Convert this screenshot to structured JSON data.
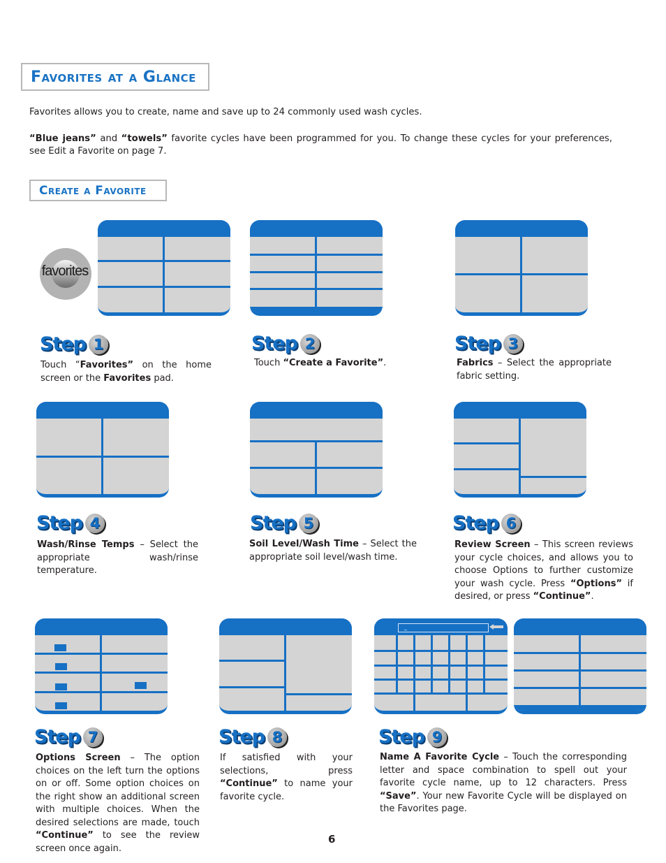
{
  "headings": {
    "main": "Favorites at a Glance",
    "sub": "Create a Favorite"
  },
  "intro": {
    "p1": "Favorites allows you to create, name and save up to 24 commonly used wash cycles.",
    "p2_bold1": "“Blue jeans”",
    "p2_mid1": " and ",
    "p2_bold2": "“towels”",
    "p2_rest": " favorite cycles have been programmed for you.  To change these cycles for your preferences, see Edit a Favorite on page 7."
  },
  "favorites_pad": {
    "label": "favorites",
    "icon": "favorites-button-icon"
  },
  "step_word": "Step",
  "steps": [
    {
      "num": "1",
      "parts": [
        [
          "",
          "Touch “"
        ],
        [
          "b",
          "Favorites”"
        ],
        [
          "",
          " on the home screen or the "
        ],
        [
          "b",
          "Favorites"
        ],
        [
          "",
          " pad."
        ]
      ]
    },
    {
      "num": "2",
      "parts": [
        [
          "",
          "Touch "
        ],
        [
          "b",
          "“Create a Favorite”"
        ],
        [
          "",
          "."
        ]
      ]
    },
    {
      "num": "3",
      "parts": [
        [
          "b",
          "Fabrics"
        ],
        [
          "",
          " – Select the appropriate fabric setting."
        ]
      ]
    },
    {
      "num": "4",
      "parts": [
        [
          "b",
          "Wash/Rinse Temps"
        ],
        [
          "",
          " – Select the appropriate wash/rinse temperature."
        ]
      ]
    },
    {
      "num": "5",
      "parts": [
        [
          "b",
          "Soil Level/Wash Time"
        ],
        [
          "",
          " – Select the appropriate soil level/wash time."
        ]
      ]
    },
    {
      "num": "6",
      "parts": [
        [
          "b",
          "Review Screen"
        ],
        [
          "",
          " – This screen reviews your cycle choices, and allows you to choose Options to further customize your wash cycle.  Press "
        ],
        [
          "b",
          "“Options”"
        ],
        [
          "",
          " if desired, or press "
        ],
        [
          "b",
          "“Continue”"
        ],
        [
          "",
          "."
        ]
      ]
    },
    {
      "num": "7",
      "parts": [
        [
          "b",
          "Options Screen"
        ],
        [
          "",
          " – The option choices on the left turn the options on or off. Some option choices on the right show an additional screen with multiple choices.  When the desired selections are made, touch "
        ],
        [
          "b",
          "“Continue”"
        ],
        [
          "",
          " to see the review screen once again."
        ]
      ]
    },
    {
      "num": "8",
      "parts": [
        [
          "",
          "If satisfied with your selections, press "
        ],
        [
          "b",
          "“Continue”"
        ],
        [
          "",
          " to name your favorite cycle."
        ]
      ]
    },
    {
      "num": "9",
      "parts": [
        [
          "b",
          "Name A Favorite Cycle"
        ],
        [
          "",
          " – Touch the corresponding letter and space combination to spell out your favorite cycle name, up to 12 characters.  Press "
        ],
        [
          "b",
          "“Save”"
        ],
        [
          "",
          ".  Your new Favorite Cycle will be displayed on the Favorites page."
        ]
      ]
    }
  ],
  "keyboard": {
    "field_value": "_",
    "backspace_icon": "backspace-arrow-icon"
  },
  "page_number": "6",
  "colors": {
    "accent": "#1670c4",
    "screen_bg": "#d4d4d4",
    "border": "#b8b8b8"
  }
}
